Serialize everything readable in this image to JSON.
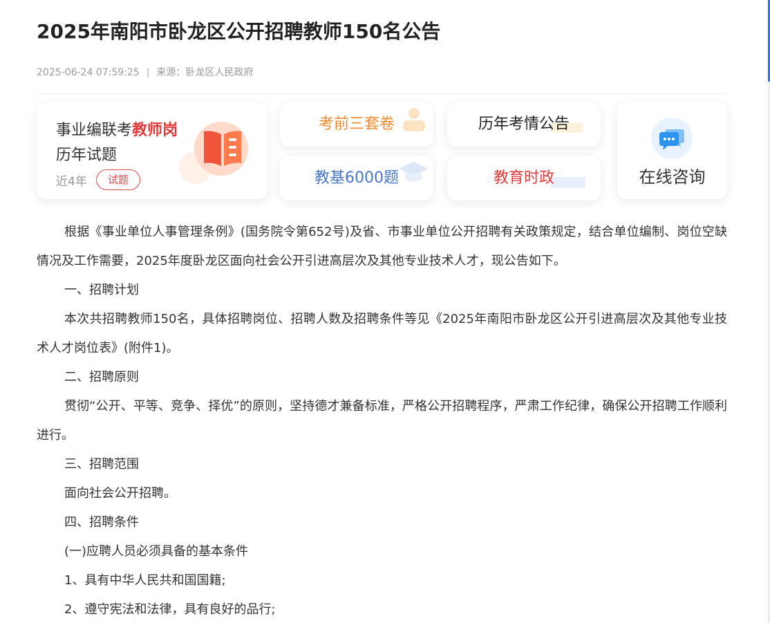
{
  "article": {
    "title": "2025年南阳市卧龙区公开招聘教师150名公告",
    "date": "2025-06-24 07:59:25",
    "separator": "|",
    "source_label": "来源：",
    "source": "卧龙区人民政府",
    "paragraphs": [
      "根据《事业单位人事管理条例》(国务院令第652号)及省、市事业单位公开招聘有关政策规定，结合单位编制、岗位空缺情况及工作需要，2025年度卧龙区面向社会公开引进高层次及其他专业技术人才，现公告如下。",
      "一、招聘计划",
      "本次共招聘教师150名，具体招聘岗位、招聘人数及招聘条件等见《2025年南阳市卧龙区公开引进高层次及其他专业技术人才岗位表》(附件1)。",
      "二、招聘原则",
      "贯彻“公开、平等、竞争、择优”的原则，坚持德才兼备标准，严格公开招聘程序，严肃工作纪律，确保公开招聘工作顺利进行。",
      "三、招聘范围",
      "面向社会公开招聘。",
      "四、招聘条件",
      "(一)应聘人员必须具备的基本条件",
      "1、具有中华人民共和国国籍;",
      "2、遵守宪法和法律，具有良好的品行;"
    ]
  },
  "promo": {
    "big_card": {
      "line1_prefix": "事业编联考",
      "line1_highlight": "教师岗",
      "line2": "历年试题",
      "years": "近4年",
      "tag": "试题",
      "icon": "book-icon"
    },
    "cards": [
      {
        "label": "考前三套卷",
        "color": "#f08a2e",
        "icon": "person-icon"
      },
      {
        "label": "教基6000题",
        "color": "#4a78c8",
        "icon": "graduation-cap-icon"
      },
      {
        "label": "历年考情公告",
        "color": "#222222",
        "icon": "note-icon"
      },
      {
        "label": "教育时政",
        "color": "#e23b3b",
        "icon": "news-icon"
      }
    ],
    "consult": {
      "label": "在线咨询",
      "icon": "chat-bubble-icon"
    }
  },
  "colors": {
    "highlight_red": "#e23b3b",
    "tag_red": "#e04848",
    "meta_gray": "#999999",
    "accent_blue": "#2f6fd6"
  }
}
